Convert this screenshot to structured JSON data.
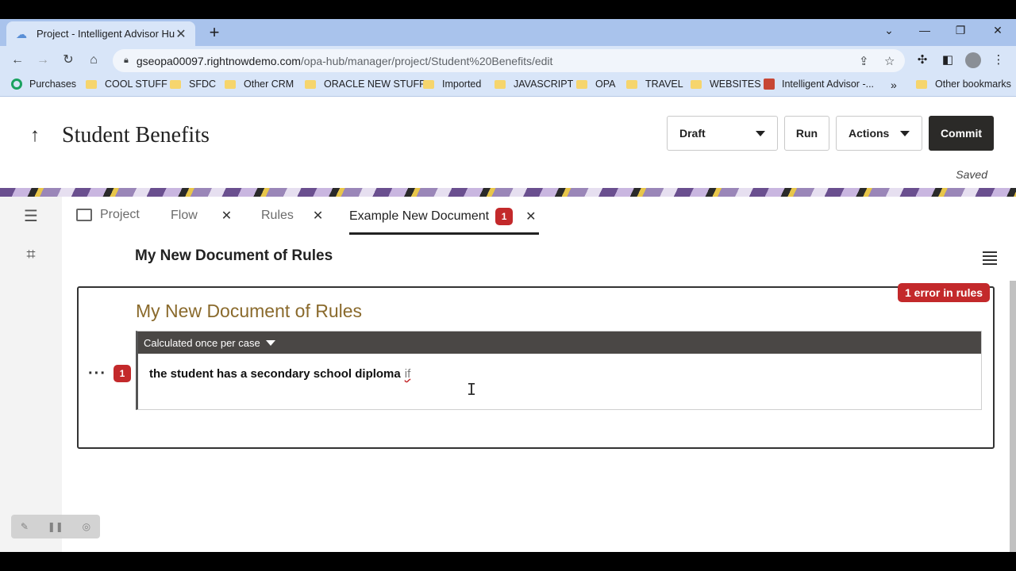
{
  "browser": {
    "tab_title": "Project - Intelligent Advisor Hub",
    "url_host": "gseopa00097.rightnowdemo.com",
    "url_path": "/opa-hub/manager/project/Student%20Benefits/edit",
    "bookmarks": [
      "Purchases",
      "COOL STUFF",
      "SFDC",
      "Other CRM",
      "ORACLE NEW STUFF",
      "Imported",
      "JAVASCRIPT",
      "OPA",
      "TRAVEL",
      "WEBSITES",
      "Intelligent Advisor -..."
    ],
    "overflow": "»",
    "other_bookmarks": "Other bookmarks"
  },
  "header": {
    "title": "Student Benefits",
    "draft_label": "Draft",
    "run_label": "Run",
    "actions_label": "Actions",
    "commit_label": "Commit",
    "saved_label": "Saved"
  },
  "tabs": {
    "project": "Project",
    "flow": "Flow",
    "rules": "Rules",
    "doc": "Example New Document",
    "doc_badge": "1"
  },
  "document": {
    "heading": "My New Document of Rules",
    "error_pill": "1 error in rules",
    "rules_title": "My New Document of Rules",
    "calc_label": "Calculated once per case",
    "rule_text": "the student has a secondary school diploma",
    "rule_if": "if",
    "row_badge": "1",
    "ellipsis": "···"
  },
  "colors": {
    "error": "#c3292b",
    "title_gold": "#8a6a2c",
    "commit_bg": "#2b2a28"
  }
}
